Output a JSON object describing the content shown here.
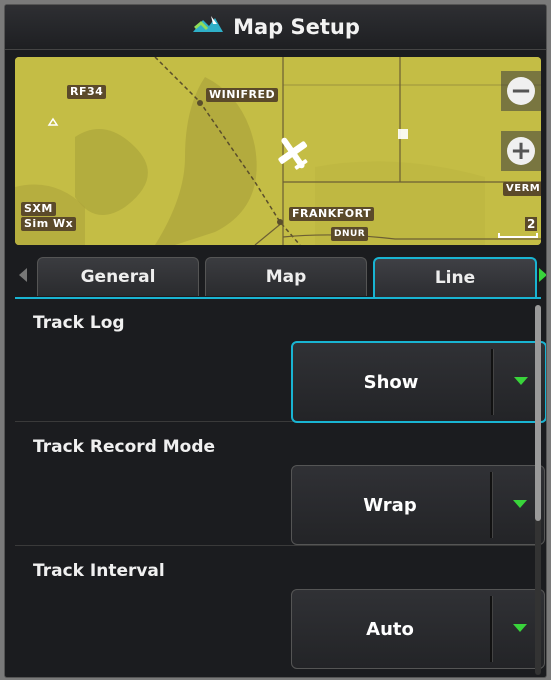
{
  "window": {
    "title": "Map Setup",
    "title_icon": "map-setup-icon"
  },
  "map": {
    "labels": {
      "airport_code": "RF34",
      "town_nw": "WINIFRED",
      "town_center": "FRANKFORT",
      "navaid": "DNUR",
      "town_east": "VERMIL",
      "weather_line1": "SXM",
      "weather_line2": "Sim Wx",
      "scale_value": "2"
    },
    "zoom_out_label": "−",
    "zoom_in_label": "+"
  },
  "tabs": [
    {
      "label": "General",
      "active": false
    },
    {
      "label": "Map",
      "active": false
    },
    {
      "label": "Line",
      "active": true
    }
  ],
  "settings": [
    {
      "label": "Track Log",
      "value": "Show",
      "focused": true
    },
    {
      "label": "Track Record Mode",
      "value": "Wrap",
      "focused": false
    },
    {
      "label": "Track Interval",
      "value": "Auto",
      "focused": false
    }
  ],
  "colors": {
    "accent": "#19b4d2",
    "caret": "#39d43b",
    "map_base": "#c9c047"
  }
}
